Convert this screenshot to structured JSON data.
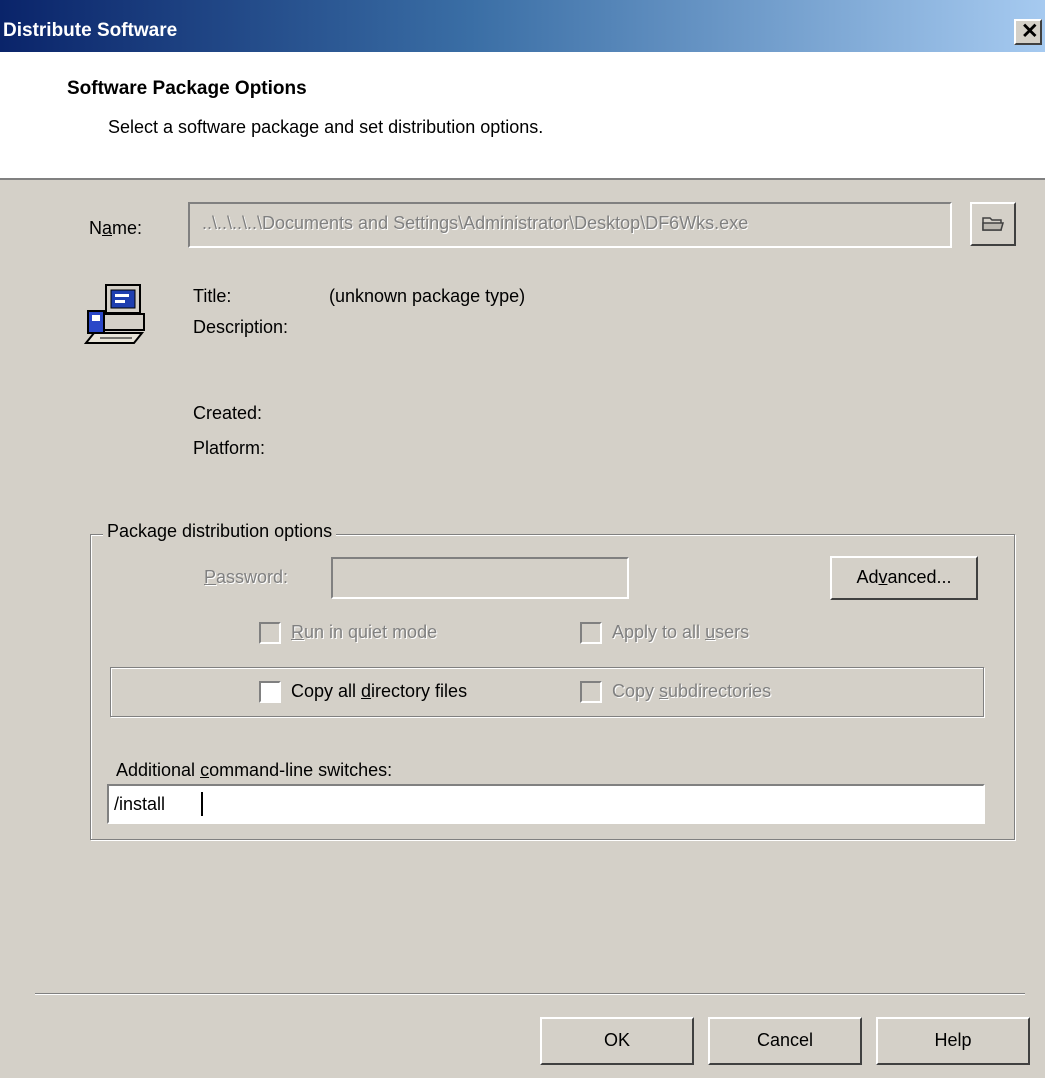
{
  "window": {
    "title": "Distribute Software",
    "close_icon": "close-icon"
  },
  "header": {
    "title": "Software Package Options",
    "subtitle": "Select a software package and set distribution options."
  },
  "package": {
    "name_label": "Name:",
    "name_value": "..\\..\\..\\..\\Documents and Settings\\Administrator\\Desktop\\DF6Wks.exe",
    "browse_icon": "folder-icon",
    "package_icon": "computer-package-icon",
    "title_label": "Title:",
    "title_value": "(unknown package type)",
    "description_label": "Description:",
    "created_label": "Created:",
    "platform_label": "Platform:"
  },
  "options": {
    "group_label": "Package distribution options",
    "password_label": "Password:",
    "password_value": "",
    "advanced_label": "Advanced...",
    "quiet_mode_label": "Run in quiet mode",
    "quiet_mode_checked": false,
    "apply_all_users_label": "Apply to all users",
    "apply_all_users_checked": false,
    "copy_dir_label": "Copy all directory files",
    "copy_dir_checked": false,
    "copy_subdirs_label": "Copy subdirectories",
    "copy_subdirs_checked": false,
    "switches_label": "Additional command-line switches:",
    "switches_value": "/install"
  },
  "buttons": {
    "ok": "OK",
    "cancel": "Cancel",
    "help": "Help"
  }
}
